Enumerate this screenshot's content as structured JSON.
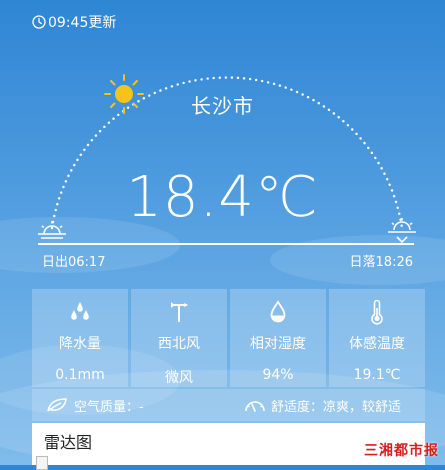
{
  "header": {
    "update_time": "09:45更新"
  },
  "location": {
    "city": "长沙市"
  },
  "current": {
    "temperature": "18.4℃"
  },
  "sun": {
    "sunrise": "日出06:17",
    "sunset": "日落18:26"
  },
  "details": [
    {
      "icon": "raindrops-icon",
      "label": "降水量",
      "value": "0.1mm"
    },
    {
      "icon": "wind-vane-icon",
      "label": "西北风",
      "value": "微风"
    },
    {
      "icon": "water-drop-icon",
      "label": "相对湿度",
      "value": "94%"
    },
    {
      "icon": "thermometer-icon",
      "label": "体感温度",
      "value": "19.1℃"
    }
  ],
  "info": {
    "air_quality": "空气质量：-",
    "comfort": "舒适度：凉爽，较舒适"
  },
  "radar": {
    "title": "雷达图"
  },
  "watermark": "三湘都市报",
  "colors": {
    "background_top": "#2f86d4",
    "background_bottom": "#7fbbeb",
    "sun": "#f7c21a",
    "watermark": "#d91e1e"
  }
}
